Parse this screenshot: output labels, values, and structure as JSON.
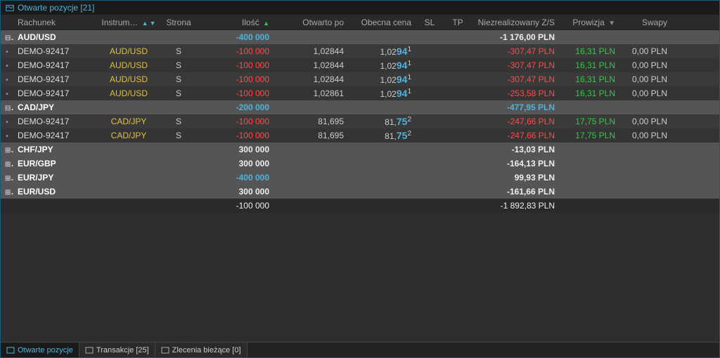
{
  "header": {
    "title": "Otwarte pozycje [21]"
  },
  "columns": {
    "account": "Rachunek",
    "instrument": "Instrum…",
    "side": "Strona",
    "qty": "Ilość",
    "open": "Otwarto po",
    "current": "Obecna cena",
    "sl": "SL",
    "tp": "TP",
    "pl": "Niezrealizowany Z/S",
    "commission": "Prowizja",
    "swaps": "Swapy"
  },
  "groups": [
    {
      "name": "AUD/USD",
      "expanded": true,
      "qty": "-400 000",
      "pl": "-1 176,00 PLN",
      "pl_class": "pl-white",
      "rows": [
        {
          "account": "DEMO-92417",
          "instr": "AUD/USD",
          "side": "S",
          "qty": "-100 000",
          "open": "1,02844",
          "cur_base": "1,02",
          "cur_big": "94",
          "cur_small": "1",
          "pl": "-307,47 PLN",
          "comm": "16,31 PLN",
          "swap": "0,00 PLN"
        },
        {
          "account": "DEMO-92417",
          "instr": "AUD/USD",
          "side": "S",
          "qty": "-100 000",
          "open": "1,02844",
          "cur_base": "1,02",
          "cur_big": "94",
          "cur_small": "1",
          "pl": "-307,47 PLN",
          "comm": "16,31 PLN",
          "swap": "0,00 PLN"
        },
        {
          "account": "DEMO-92417",
          "instr": "AUD/USD",
          "side": "S",
          "qty": "-100 000",
          "open": "1,02844",
          "cur_base": "1,02",
          "cur_big": "94",
          "cur_small": "1",
          "pl": "-307,47 PLN",
          "comm": "16,31 PLN",
          "swap": "0,00 PLN"
        },
        {
          "account": "DEMO-92417",
          "instr": "AUD/USD",
          "side": "S",
          "qty": "-100 000",
          "open": "1,02861",
          "cur_base": "1,02",
          "cur_big": "94",
          "cur_small": "1",
          "pl": "-253,58 PLN",
          "comm": "16,31 PLN",
          "swap": "0,00 PLN"
        }
      ]
    },
    {
      "name": "CAD/JPY",
      "expanded": true,
      "qty": "-200 000",
      "pl": "-477,95 PLN",
      "pl_class": "pl-blue",
      "rows": [
        {
          "account": "DEMO-92417",
          "instr": "CAD/JPY",
          "side": "S",
          "qty": "-100 000",
          "open": "81,695",
          "cur_base": "81,",
          "cur_big": "75",
          "cur_small": "2",
          "pl": "-247,66 PLN",
          "comm": "17,75 PLN",
          "swap": "0,00 PLN"
        },
        {
          "account": "DEMO-92417",
          "instr": "CAD/JPY",
          "side": "S",
          "qty": "-100 000",
          "open": "81,695",
          "cur_base": "81,",
          "cur_big": "75",
          "cur_small": "2",
          "pl": "-247,66 PLN",
          "comm": "17,75 PLN",
          "swap": "0,00 PLN"
        }
      ]
    },
    {
      "name": "CHF/JPY",
      "expanded": false,
      "qty": "300 000",
      "pl": "-13,03 PLN",
      "pl_class": "pl-white",
      "rows": []
    },
    {
      "name": "EUR/GBP",
      "expanded": false,
      "qty": "300 000",
      "pl": "-164,13 PLN",
      "pl_class": "pl-white",
      "rows": []
    },
    {
      "name": "EUR/JPY",
      "expanded": false,
      "qty": "-400 000",
      "pl": "99,93 PLN",
      "pl_class": "pl-white",
      "rows": []
    },
    {
      "name": "EUR/USD",
      "expanded": false,
      "qty": "300 000",
      "pl": "-161,66 PLN",
      "pl_class": "pl-white",
      "rows": []
    }
  ],
  "total": {
    "qty": "-100 000",
    "pl": "-1 892,83 PLN"
  },
  "tabs": [
    {
      "id": "open",
      "label": "Otwarte pozycje",
      "active": true
    },
    {
      "id": "trans",
      "label": "Transakcje [25]",
      "active": false
    },
    {
      "id": "orders",
      "label": "Zlecenia bieżące [0]",
      "active": false
    }
  ]
}
